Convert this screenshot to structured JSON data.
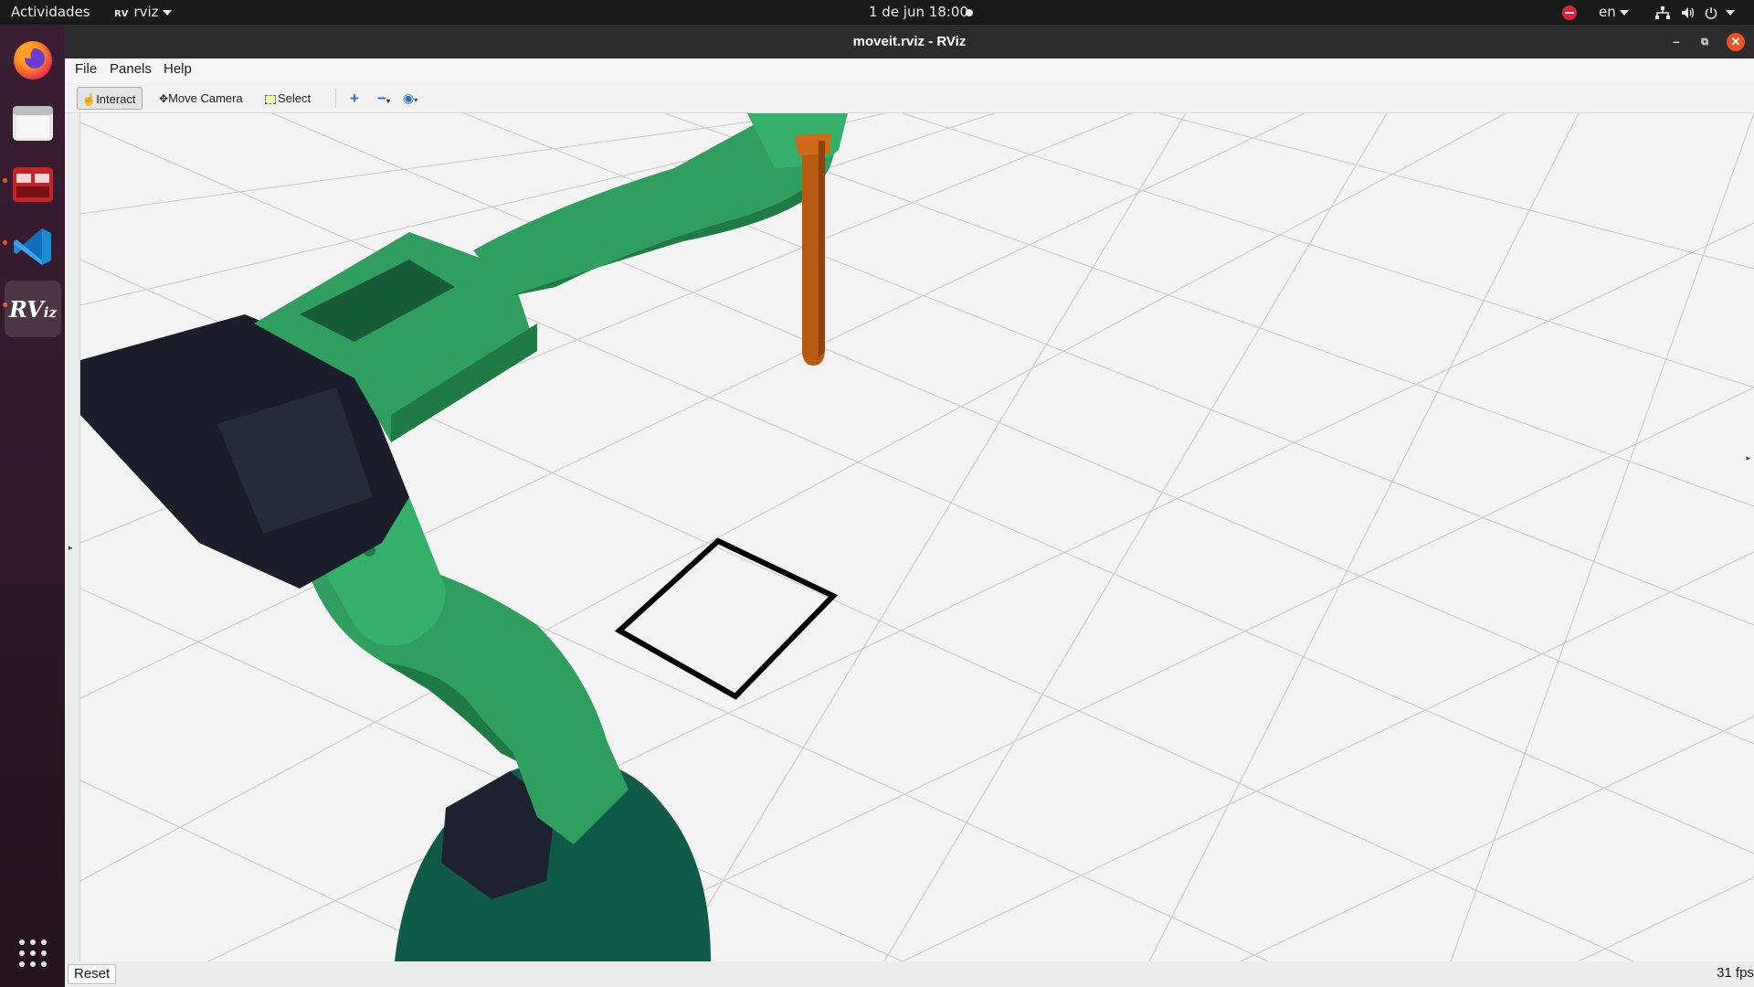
{
  "topbar": {
    "activities": "Actividades",
    "app_name": "rviz",
    "datetime": "1 de jun  18:00",
    "language": "en"
  },
  "window": {
    "title": "moveit.rviz - RViz"
  },
  "menu": {
    "file": "File",
    "panels": "Panels",
    "help": "Help"
  },
  "toolbar": {
    "interact": "Interact",
    "move_camera": "Move Camera",
    "select": "Select"
  },
  "status": {
    "reset_label": "Reset",
    "fps": "31 fps"
  },
  "colors": {
    "robot_link": "#2f9e5e",
    "robot_link_dark": "#1f7a45",
    "servo": "#1b1e2a",
    "tool": "#b85a12",
    "accent": "#e95420"
  },
  "dock": {
    "icons": [
      "firefox-icon",
      "files-icon",
      "terminal-icon",
      "vscode-icon",
      "rviz-icon",
      "app-grid-icon"
    ]
  }
}
